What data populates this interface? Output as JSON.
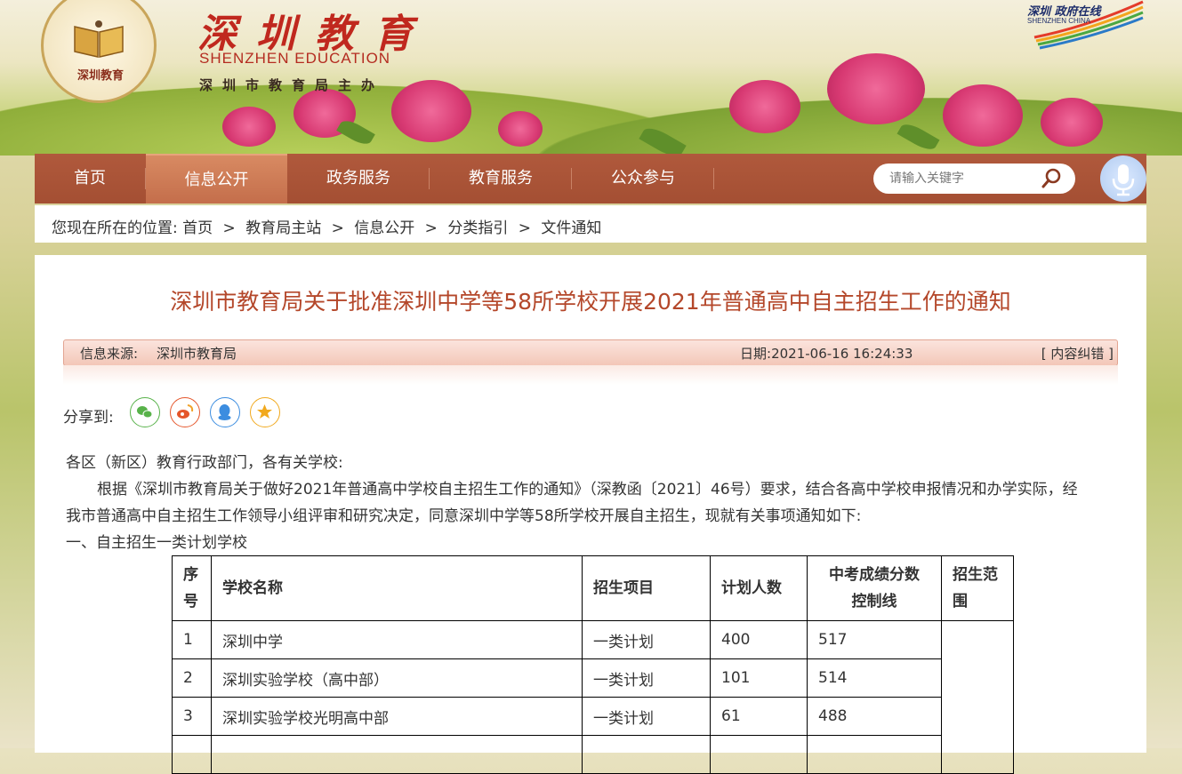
{
  "banner": {
    "logo_text": "深圳教育",
    "title_cn": "深圳教育",
    "title_en": "SHENZHEN EDUCATION",
    "subtitle": "深圳市教育局主办",
    "portal_cn": "深圳 政府在线",
    "portal_en": "SHENZHEN CHINA"
  },
  "nav": {
    "items": [
      {
        "label": "首页"
      },
      {
        "label": "信息公开"
      },
      {
        "label": "政务服务"
      },
      {
        "label": "教育服务"
      },
      {
        "label": "公众参与"
      }
    ],
    "active_index": 1,
    "search_placeholder": "请输入关键字",
    "icons": {
      "search": "search-icon",
      "voice": "microphone-icon"
    }
  },
  "breadcrumb": {
    "prefix": "您现在所在的位置:",
    "items": [
      "首页",
      "教育局主站",
      "信息公开",
      "分类指引",
      "文件通知"
    ],
    "separator": ">"
  },
  "article": {
    "title": "深圳市教育局关于批准深圳中学等58所学校开展2021年普通高中自主招生工作的通知",
    "source_label": "信息来源:",
    "source_value": "深圳市教育局",
    "date_label": "日期:",
    "date_value": "2021-06-16 16:24:33",
    "error_link": "[ 内容纠错 ]",
    "share_label": "分享到:",
    "share_icons": [
      "wechat-icon",
      "weibo-icon",
      "qq-icon",
      "qzone-icon"
    ],
    "greeting": "各区（新区）教育行政部门，各有关学校:",
    "para1_line1": "根据《深圳市教育局关于做好2021年普通高中学校自主招生工作的通知》（深教函〔2021〕46号）要求，结合各高中学校申报情况和办学实际，经",
    "para1_line2": "我市普通高中自主招生工作领导小组评审和研究决定，同意深圳中学等58所学校开展自主招生，现就有关事项通知如下:",
    "section1": "一、自主招生一类计划学校"
  },
  "table": {
    "headers": {
      "no_1": "序",
      "no_2": "号",
      "school": "学校名称",
      "project": "招生项目",
      "plan": "计划人数",
      "score_1": "中考成绩分数",
      "score_2": "控制线",
      "range_1": "招生范",
      "range_2": "围"
    },
    "rows": [
      {
        "no": "1",
        "school": "深圳中学",
        "project": "一类计划",
        "plan": "400",
        "score": "517"
      },
      {
        "no": "2",
        "school": "深圳实验学校（高中部）",
        "project": "一类计划",
        "plan": "101",
        "score": "514"
      },
      {
        "no": "3",
        "school": "深圳实验学校光明高中部",
        "project": "一类计划",
        "plan": "61",
        "score": "488"
      },
      {
        "no": "",
        "school": "",
        "project": "",
        "plan": "",
        "score": ""
      }
    ]
  },
  "colors": {
    "nav_bg": "#a44f33",
    "title_color": "#b4472a",
    "brand_red": "#c0281e"
  }
}
